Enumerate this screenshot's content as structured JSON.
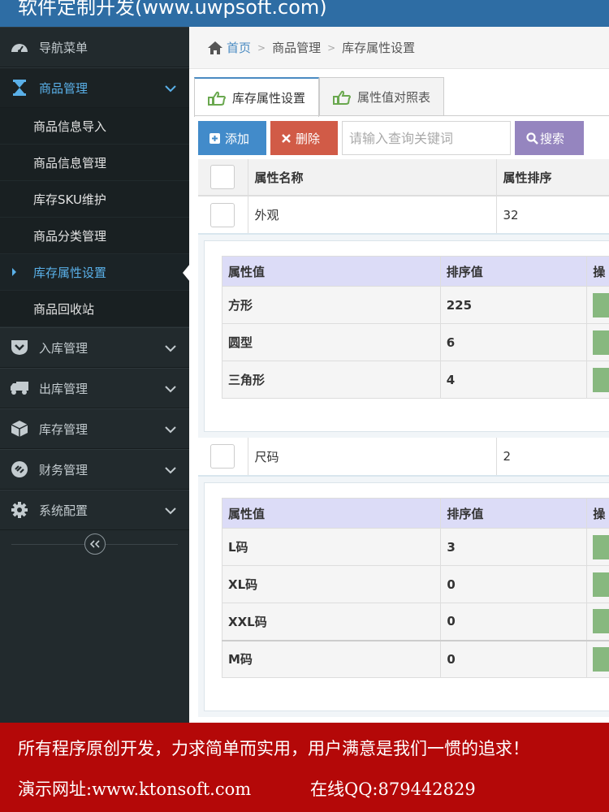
{
  "header": {
    "brand": "软件定制开发(www.uwpsoft.com)"
  },
  "sidebar": {
    "nav_title": "导航菜单",
    "items": [
      {
        "label": "商品管理",
        "icon": "hourglass-icon",
        "expanded": true
      },
      {
        "label": "入库管理",
        "icon": "shield-down-icon"
      },
      {
        "label": "出库管理",
        "icon": "truck-icon"
      },
      {
        "label": "库存管理",
        "icon": "cube-icon"
      },
      {
        "label": "财务管理",
        "icon": "link-icon"
      },
      {
        "label": "系统配置",
        "icon": "gear-icon"
      }
    ],
    "sub_items": [
      "商品信息导入",
      "商品信息管理",
      "库存SKU维护",
      "商品分类管理",
      "库存属性设置",
      "商品回收站"
    ],
    "active_sub": "库存属性设置"
  },
  "breadcrumb": {
    "home": "首页",
    "level1": "商品管理",
    "level2": "库存属性设置"
  },
  "tabs": [
    {
      "label": "库存属性设置",
      "active": true
    },
    {
      "label": "属性值对照表",
      "active": false
    }
  ],
  "toolbar": {
    "add_label": "添加",
    "delete_label": "删除",
    "search_placeholder": "请输入查询关键词",
    "search_label": "搜索"
  },
  "grid": {
    "columns": [
      "属性名称",
      "属性排序"
    ],
    "rows": [
      {
        "name": "外观",
        "sort": "32",
        "detail": {
          "columns": [
            "属性值",
            "排序值",
            "操"
          ],
          "rows": [
            {
              "value": "方形",
              "sort": "225"
            },
            {
              "value": "圆型",
              "sort": "6"
            },
            {
              "value": "三角形",
              "sort": "4"
            }
          ]
        }
      },
      {
        "name": "尺码",
        "sort": "2",
        "detail": {
          "columns": [
            "属性值",
            "排序值",
            "操"
          ],
          "rows": [
            {
              "value": "L码",
              "sort": "3"
            },
            {
              "value": "XL码",
              "sort": "0"
            },
            {
              "value": "XXL码",
              "sort": "0"
            },
            {
              "value": "M码",
              "sort": "0"
            }
          ]
        }
      }
    ]
  },
  "footer": {
    "slogan": "所有程序原创开发，力求简单而实用，用户满意是我们一惯的追求！",
    "site": "演示网址:www.ktonsoft.com",
    "qq": "在线QQ:879442829"
  },
  "colors": {
    "header_bg": "#2e6da4",
    "sidebar_bg": "#222a2d",
    "active_text": "#5ab0e8",
    "add_button": "#428bca",
    "delete_button": "#d15b47",
    "search_button": "#9585bf",
    "footer_bg": "#b40808"
  }
}
